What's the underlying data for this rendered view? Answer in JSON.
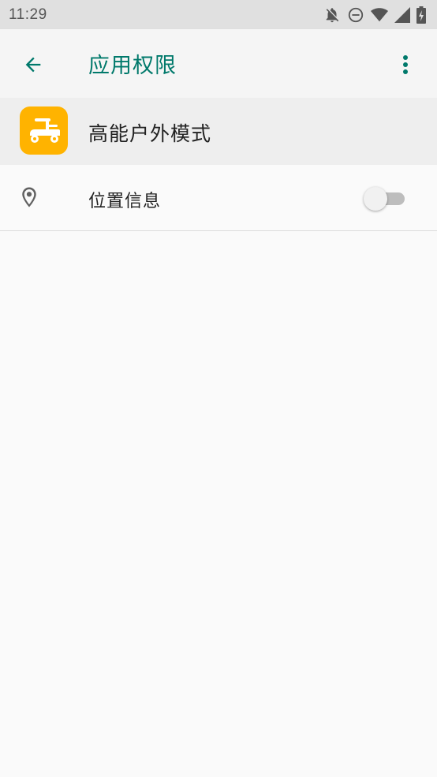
{
  "status_bar": {
    "time": "11:29",
    "icons": [
      "notifications-off-icon",
      "do-not-disturb-icon",
      "wifi-icon",
      "signal-icon",
      "battery-charging-icon"
    ]
  },
  "app_bar": {
    "title": "应用权限",
    "back_icon": "arrow-back-icon",
    "menu_icon": "more-vert-icon",
    "accent_color": "#00796b"
  },
  "app": {
    "name": "高能户外模式",
    "icon": "scooter-icon",
    "icon_bg": "#ffb300"
  },
  "permissions": [
    {
      "label": "位置信息",
      "icon": "location-pin-icon",
      "enabled": false
    }
  ]
}
